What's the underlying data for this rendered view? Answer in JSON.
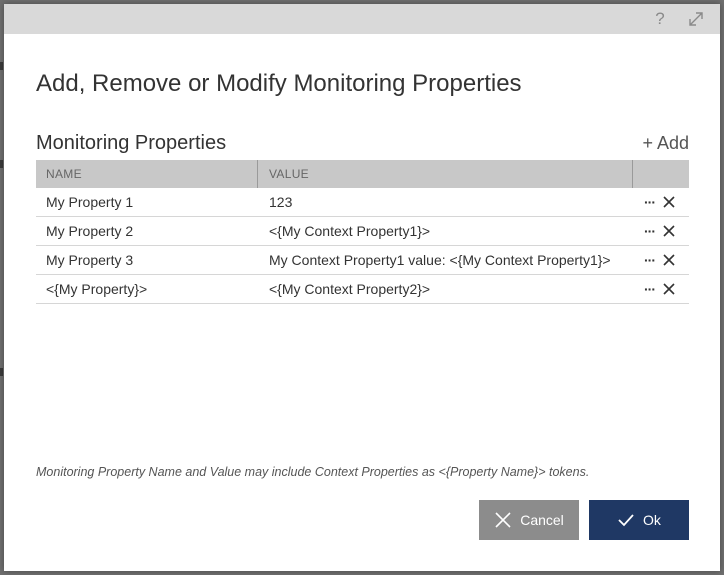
{
  "dialog": {
    "title": "Add, Remove or Modify Monitoring Properties",
    "help_icon": "question-icon",
    "maximize_icon": "expand-icon"
  },
  "section": {
    "title": "Monitoring Properties",
    "add_label": "Add"
  },
  "grid": {
    "columns": [
      "NAME",
      "VALUE"
    ],
    "rows": [
      {
        "name": "My Property 1",
        "value": "123"
      },
      {
        "name": "My Property 2",
        "value": "<{My Context Property1}>"
      },
      {
        "name": "My Property 3",
        "value": "My Context Property1 value: <{My Context Property1}>"
      },
      {
        "name": "<{My Property}>",
        "value": "<{My Context Property2}>"
      }
    ],
    "row_actions": {
      "more": "···",
      "delete_icon": "close-icon"
    }
  },
  "hint": "Monitoring Property Name and Value may include Context Properties as <{Property Name}> tokens.",
  "footer": {
    "cancel_label": "Cancel",
    "ok_label": "Ok"
  },
  "colors": {
    "titlebar": "#d9d9d9",
    "grid_header": "#c8c8c8",
    "cancel_button": "#8c8c8c",
    "ok_button": "#1f3864"
  }
}
